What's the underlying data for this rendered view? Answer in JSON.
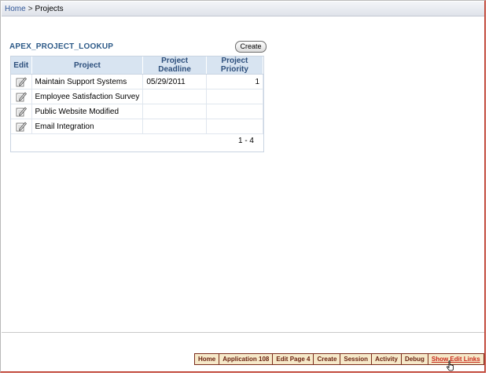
{
  "breadcrumb": {
    "home": "Home",
    "separator": ">",
    "current": "Projects"
  },
  "region": {
    "title": "APEX_PROJECT_LOOKUP",
    "create_label": "Create"
  },
  "report": {
    "columns": [
      "Edit",
      "Project",
      "Project Deadline",
      "Project Priority"
    ],
    "rows": [
      {
        "project": "Maintain Support Systems",
        "deadline": "05/29/2011",
        "priority": "1"
      },
      {
        "project": "Employee Satisfaction Survey",
        "deadline": "",
        "priority": ""
      },
      {
        "project": "Public Website Modified",
        "deadline": "",
        "priority": ""
      },
      {
        "project": "Email Integration",
        "deadline": "",
        "priority": ""
      }
    ],
    "pagination": "1 - 4",
    "edit_icon": "pencil-edit-icon"
  },
  "developer_toolbar": {
    "items": [
      "Home",
      "Application 108",
      "Edit Page 4",
      "Create",
      "Session",
      "Activity",
      "Debug",
      "Show Edit Links"
    ]
  },
  "colors": {
    "accent": "#2d5a88",
    "header_bg": "#d8e4f1",
    "toolbar_border": "#7b2d1d",
    "active_link": "#c8281b"
  }
}
